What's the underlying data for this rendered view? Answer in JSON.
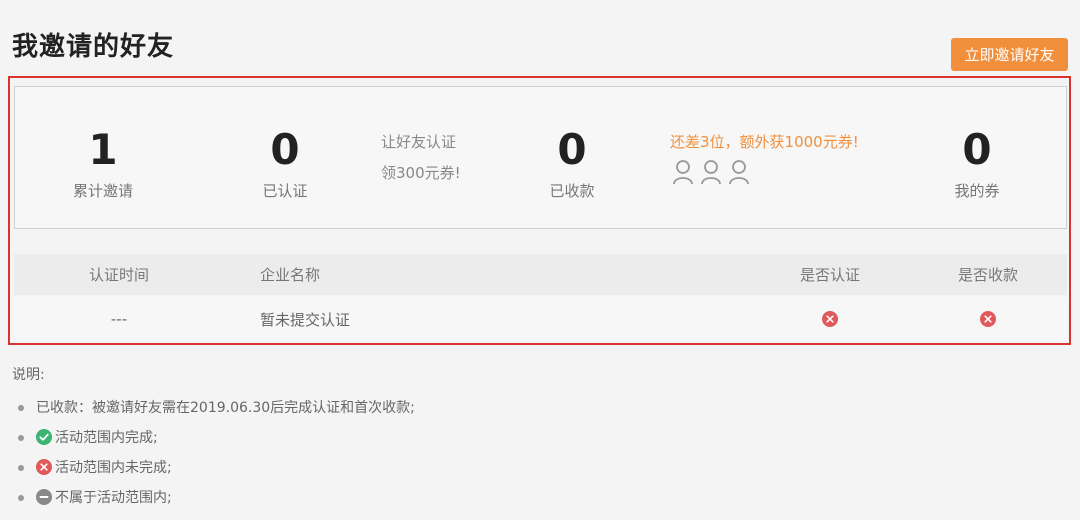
{
  "header": {
    "title": "我邀请的好友",
    "invite_button": "立即邀请好友"
  },
  "stats": {
    "total_invited": {
      "value": "1",
      "label": "累计邀请"
    },
    "verified": {
      "value": "0",
      "label": "已认证"
    },
    "promo_line1": "让好友认证",
    "promo_line2": "领300元券!",
    "paid": {
      "value": "0",
      "label": "已收款"
    },
    "bonus_text": "还差3位，额外获1000元券!",
    "my_coupons": {
      "value": "0",
      "label": "我的券"
    }
  },
  "table": {
    "columns": [
      "认证时间",
      "企业名称",
      "是否认证",
      "是否收款"
    ],
    "rows": [
      {
        "time": "---",
        "company": "暂未提交认证",
        "verified": "no",
        "paid": "no"
      }
    ]
  },
  "notes": {
    "title": "说明:",
    "items": [
      "已收款：被邀请好友需在2019.06.30后完成认证和首次收款;",
      "活动范围内完成;",
      "活动范围内未完成;",
      "不属于活动范围内;"
    ]
  },
  "colors": {
    "accent": "#f28f3d",
    "frame_red": "#d9322f",
    "status_green": "#3cb371",
    "status_red": "#e05a5a",
    "status_gray": "#888888"
  },
  "icons": {
    "complete": "check-circle-icon",
    "incomplete": "x-circle-icon",
    "excluded": "minus-circle-icon",
    "avatar": "user-outline-icon"
  }
}
